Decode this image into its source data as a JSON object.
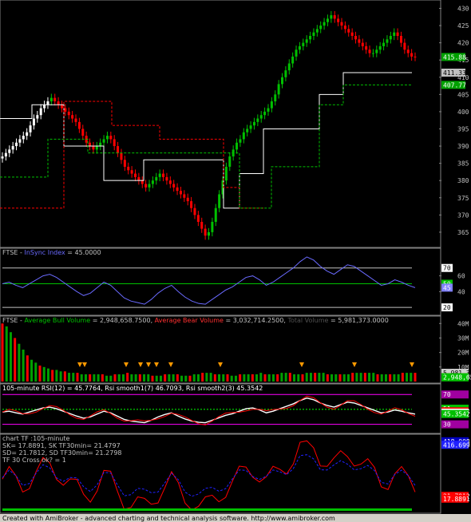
{
  "footer": {
    "text": "Created with AmiBroker - advanced charting and technical analysis software. http://www.amibroker.com"
  },
  "colors": {
    "bg": "#000000",
    "frame": "#808080",
    "up": "#00c000",
    "down": "#ff0000",
    "white": "#ffffff"
  },
  "panes": [
    {
      "id": "price",
      "axis_ticks": [
        "430",
        "425",
        "420",
        "415",
        "410",
        "405",
        "400",
        "395",
        "390",
        "385",
        "380",
        "375",
        "370",
        "365"
      ],
      "tick_values": [
        430,
        425,
        420,
        415,
        410,
        405,
        400,
        395,
        390,
        385,
        380,
        375,
        370,
        365
      ],
      "ylim": [
        361.5,
        431.5
      ],
      "value_tags": [
        {
          "text": "415.88",
          "value": 415.88,
          "bg": "#00a000",
          "fg": "#ffffff"
        },
        {
          "text": "411.33",
          "value": 411.33,
          "bg": "#c0c0c0",
          "fg": "#000000"
        },
        {
          "text": "407.77",
          "value": 407.77,
          "bg": "#00a000",
          "fg": "#ffffff"
        }
      ]
    },
    {
      "id": "insync",
      "title_parts": [
        {
          "text": "FTSE - ",
          "color": "#c0c0c0"
        },
        {
          "text": "InSync Index",
          "color": "#6a6aff"
        },
        {
          "text": " = 45.0000",
          "color": "#c0c0c0"
        }
      ],
      "axis_ticks": [
        "60",
        "40"
      ],
      "tick_values": [
        60,
        40
      ],
      "ylim": [
        12,
        93
      ],
      "hlines": [
        {
          "value": 70,
          "color": "#c0c0c0"
        },
        {
          "value": 50,
          "color": "#00c000"
        },
        {
          "value": 20,
          "color": "#c0c0c0"
        }
      ],
      "value_tags": [
        {
          "text": "70",
          "value": 70,
          "bg": "#ffffff",
          "fg": "#000000"
        },
        {
          "text": "50",
          "value": 50,
          "bg": "#00c000",
          "fg": "#ffffff"
        },
        {
          "text": "45",
          "value": 45,
          "bg": "#8080ff",
          "fg": "#ffffff"
        },
        {
          "text": "20",
          "value": 20,
          "bg": "#ffffff",
          "fg": "#000000"
        }
      ]
    },
    {
      "id": "volume",
      "title_parts": [
        {
          "text": "FTSE - ",
          "color": "#c0c0c0"
        },
        {
          "text": "Average Bull Volume",
          "color": "#00c000"
        },
        {
          "text": " = 2,948,658.7500, ",
          "color": "#c0c0c0"
        },
        {
          "text": "Average Bear Volume",
          "color": "#ff3030"
        },
        {
          "text": " = 3,032,714.2500, ",
          "color": "#c0c0c0"
        },
        {
          "text": "Total Volume",
          "color": "#505050"
        },
        {
          "text": " = 5,981,373.0000",
          "color": "#c0c0c0"
        }
      ],
      "axis_ticks": [
        "40M",
        "30M",
        "20M",
        "10M"
      ],
      "tick_values": [
        40,
        30,
        20,
        10
      ],
      "ylim": [
        0,
        44
      ],
      "value_tags": [
        {
          "text": "5,981,373",
          "value": 6.0,
          "bg": "#d0d0d0",
          "fg": "#000000"
        },
        {
          "text": "3,032,714",
          "value": 3.0,
          "bg": "#ff0000",
          "fg": "#ffffff"
        },
        {
          "text": "2,948,659",
          "value": 2.95,
          "bg": "#00c000",
          "fg": "#ffffff"
        },
        {
          "text": "2,948,659",
          "value": 2.9,
          "bg": "#00c000",
          "fg": "#ffffff"
        }
      ]
    },
    {
      "id": "rsi",
      "title_parts": [
        {
          "text": "105-minute RSI(12) = 45.7764, ",
          "color": "#ffffff"
        },
        {
          "text": "Rsi smooth1(7) 46.7093, ",
          "color": "#ffffff"
        },
        {
          "text": "Rsi smooth2(3) 45.3542",
          "color": "#ffffff"
        }
      ],
      "ylim": [
        20,
        82
      ],
      "hlines": [
        {
          "value": 70,
          "color": "#ff00ff"
        },
        {
          "value": 50,
          "color": "#00ff00",
          "dashed": true
        },
        {
          "value": 30,
          "color": "#ff00ff"
        }
      ],
      "value_tags": [
        {
          "text": "70",
          "value": 70,
          "bg": "#a000a0",
          "fg": "#ffffff"
        },
        {
          "text": "51",
          "value": 51,
          "bg": "#00c000",
          "fg": "#ffffff"
        },
        {
          "text": "46.7093",
          "value": 47.5,
          "bg": "#ff0000",
          "fg": "#ffffff"
        },
        {
          "text": "45.7764",
          "value": 45.7,
          "bg": "#ffffff",
          "fg": "#000000"
        },
        {
          "text": "45.3542",
          "value": 43.9,
          "bg": "#00c000",
          "fg": "#ffffff"
        },
        {
          "text": "30",
          "value": 30,
          "bg": "#a000a0",
          "fg": "#ffffff"
        }
      ]
    },
    {
      "id": "stoch",
      "title_lines": [
        "chart TF :105-minute",
        "SK= 17.8891,  SK TF30min= 21.4797",
        "SD= 21.7812,  SD TF30min= 21.2798",
        " TF 30 Cross ok? = 1"
      ],
      "ylim": [
        0,
        105
      ],
      "value_tags": [
        {
          "text": "418.008",
          "value": 97.5,
          "bg": "#0000c0",
          "fg": "#ffffff"
        },
        {
          "text": "416.699",
          "value": 92.5,
          "bg": "#2020ff",
          "fg": "#ffffff"
        },
        {
          "text": "21.7812",
          "value": 21.8,
          "bg": "#ff0000",
          "fg": "#ffffff"
        },
        {
          "text": "17.8891",
          "value": 17.9,
          "bg": "#ff0000",
          "fg": "#ffffff"
        }
      ]
    }
  ],
  "chart_data": {
    "type": "line",
    "series": [
      {
        "name": "InSync Index",
        "values": [
          50,
          52,
          48,
          45,
          50,
          55,
          60,
          62,
          58,
          52,
          46,
          40,
          35,
          38,
          45,
          52,
          48,
          40,
          32,
          28,
          26,
          24,
          30,
          38,
          44,
          48,
          40,
          33,
          28,
          25,
          24,
          30,
          36,
          42,
          46,
          52,
          58,
          60,
          55,
          48,
          52,
          58,
          64,
          70,
          78,
          84,
          80,
          72,
          66,
          62,
          68,
          74,
          72,
          66,
          60,
          54,
          48,
          50,
          55,
          52,
          48,
          45
        ]
      },
      {
        "name": "105-minute RSI(12)",
        "values": [
          45.8
        ]
      },
      {
        "name": "Rsi smooth1(7)",
        "values": [
          46.7
        ]
      },
      {
        "name": "Rsi smooth2(3)",
        "values": [
          45.4
        ]
      },
      {
        "name": "SK",
        "values": [
          17.9
        ]
      },
      {
        "name": "SD",
        "values": [
          21.8
        ]
      }
    ],
    "price": {
      "ylim": [
        361.5,
        431.5
      ],
      "closes": [
        387,
        388,
        389,
        390,
        391,
        392,
        393,
        394,
        396,
        398,
        399,
        401,
        402,
        403,
        404,
        403,
        402,
        401,
        400,
        399,
        398,
        397,
        395,
        393,
        391,
        390,
        389,
        390,
        391,
        392,
        393,
        392,
        390,
        388,
        386,
        384,
        383,
        382,
        381,
        380,
        379,
        378,
        379,
        380,
        381,
        382,
        381,
        380,
        379,
        378,
        377,
        376,
        375,
        374,
        372,
        370,
        368,
        366,
        364,
        365,
        368,
        372,
        376,
        380,
        384,
        387,
        389,
        391,
        392,
        394,
        395,
        396,
        397,
        398,
        399,
        400,
        401,
        403,
        405,
        408,
        410,
        412,
        414,
        416,
        418,
        419,
        420,
        421,
        422,
        423,
        424,
        425,
        426,
        427,
        428,
        427,
        426,
        425,
        424,
        423,
        422,
        421,
        420,
        419,
        418,
        417,
        417,
        418,
        419,
        420,
        421,
        422,
        423,
        422,
        420,
        418,
        417,
        416,
        415.88
      ]
    },
    "volume": {
      "ylim": [
        0,
        44
      ],
      "values": [
        40,
        38,
        34,
        30,
        26,
        22,
        18,
        15,
        13,
        11,
        10,
        9,
        8,
        8,
        7,
        7,
        6,
        6,
        6,
        5,
        5,
        5,
        5,
        5,
        5,
        4,
        4,
        5,
        5,
        5,
        6,
        5,
        5,
        5,
        5,
        5,
        4,
        4,
        4,
        5,
        5,
        5,
        5,
        4,
        4,
        4,
        5,
        5,
        6,
        6,
        6,
        5,
        5,
        5,
        5,
        4,
        4,
        5,
        5,
        5,
        5,
        5,
        6,
        5,
        5,
        5,
        5,
        6,
        6,
        6,
        5,
        5,
        5,
        6,
        6,
        6,
        6,
        6,
        5,
        5,
        5,
        5,
        5,
        5,
        6,
        6,
        6,
        6,
        6,
        6,
        5,
        5,
        5,
        5,
        5,
        5,
        6,
        6,
        6,
        6
      ]
    }
  }
}
